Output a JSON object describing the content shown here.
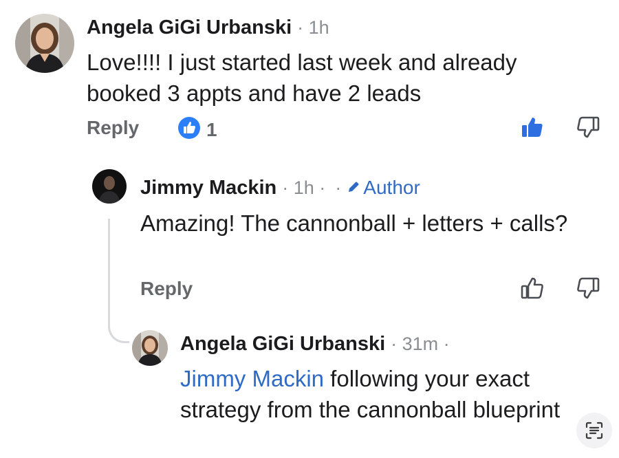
{
  "comments": [
    {
      "author": "Angela GiGi Urbanski",
      "time": "· 1h",
      "text": "Love!!!! I just started last week and already booked 3 appts and have 2 leads",
      "reply_label": "Reply",
      "reaction_count": "1"
    },
    {
      "author": "Jimmy Mackin",
      "time": "· 1h ·",
      "separator": "·",
      "badge": "Author",
      "text": "Amazing! The cannonball + letters + calls?",
      "reply_label": "Reply"
    },
    {
      "author": "Angela GiGi Urbanski",
      "time": "· 31m ·",
      "mention": "Jimmy Mackin",
      "text": " following your exact strategy from the cannonball blueprint"
    }
  ],
  "colors": {
    "accent": "#2f6bc4",
    "reaction_blue": "#2d7ff9",
    "muted": "#65676b"
  },
  "icons": [
    "like-reaction-icon",
    "thumbs-up-icon",
    "thumbs-down-icon",
    "pencil-icon",
    "text-scan-icon"
  ]
}
